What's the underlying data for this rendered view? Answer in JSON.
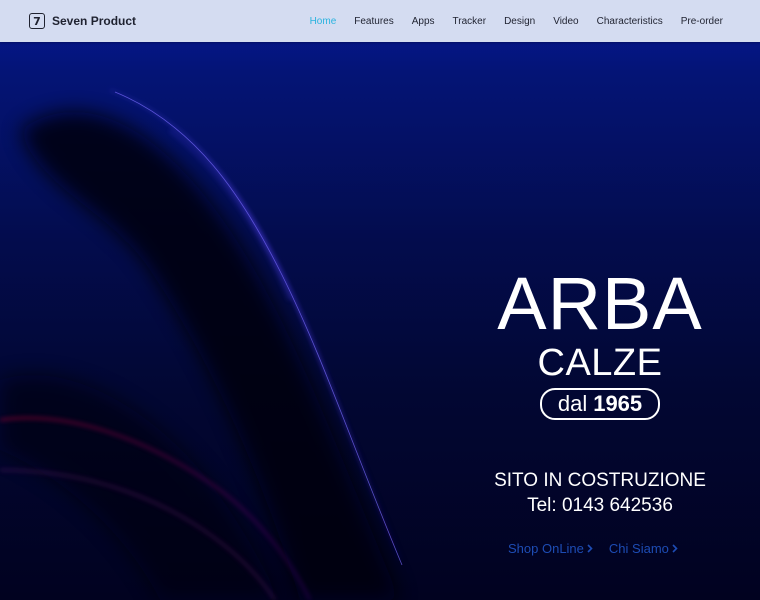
{
  "brand": {
    "icon_digit": "7",
    "name": "Seven Product",
    "icon": "seven-logo-icon"
  },
  "nav": {
    "active_color": "#2ab3df",
    "items": [
      {
        "label": "Home",
        "active": true
      },
      {
        "label": "Features",
        "active": false
      },
      {
        "label": "Apps",
        "active": false
      },
      {
        "label": "Tracker",
        "active": false
      },
      {
        "label": "Design",
        "active": false
      },
      {
        "label": "Video",
        "active": false
      },
      {
        "label": "Characteristics",
        "active": false
      },
      {
        "label": "Pre-order",
        "active": false
      }
    ]
  },
  "hero": {
    "title": "ARBA",
    "subtitle": "CALZE",
    "since_prefix": "dal",
    "since_year": "1965",
    "status": "SITO IN COSTRUZIONE",
    "phone": "Tel: 0143 642536",
    "links": [
      {
        "label": "Shop OnLine",
        "icon": "chevron-right-icon"
      },
      {
        "label": "Chi Siamo",
        "icon": "chevron-right-icon"
      }
    ],
    "link_color": "#1d4cb4"
  }
}
